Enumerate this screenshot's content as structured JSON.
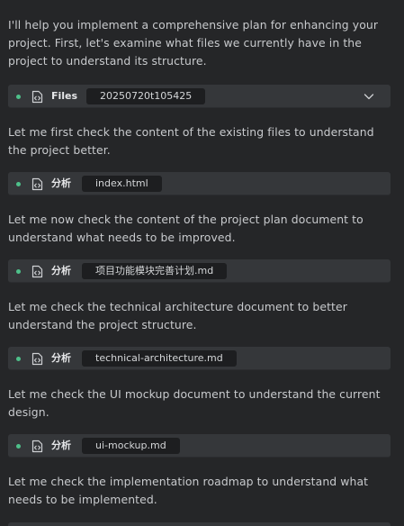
{
  "messages": {
    "intro": "I'll help you implement a comprehensive plan for enhancing your project. First, let's examine what files we currently have in the project to understand its structure.",
    "check_existing": "Let me first check the content of the existing files to understand the project better.",
    "check_plan": "Let me now check the content of the project plan document to understand what needs to be improved.",
    "check_arch": "Let me check the technical architecture document to better understand the project structure.",
    "check_ui": "Let me check the UI mockup document to understand the current design.",
    "check_roadmap": "Let me check the implementation roadmap to understand what needs to be implemented."
  },
  "tool_calls": [
    {
      "label": "Files",
      "target": "20250720t105425",
      "expandable": true
    },
    {
      "label": "分析",
      "target": "index.html"
    },
    {
      "label": "分析",
      "target": "项目功能模块完善计划.md"
    },
    {
      "label": "分析",
      "target": "technical-architecture.md"
    },
    {
      "label": "分析",
      "target": "ui-mockup.md"
    }
  ],
  "icons": {
    "status": "status-dot-icon",
    "file": "code-file-icon",
    "expand": "chevron-down-icon"
  },
  "colors": {
    "background": "#252628",
    "card": "#35373a",
    "chip": "#1d1e20",
    "status_dot": "#4ec08a",
    "text": "#c8cacd"
  }
}
